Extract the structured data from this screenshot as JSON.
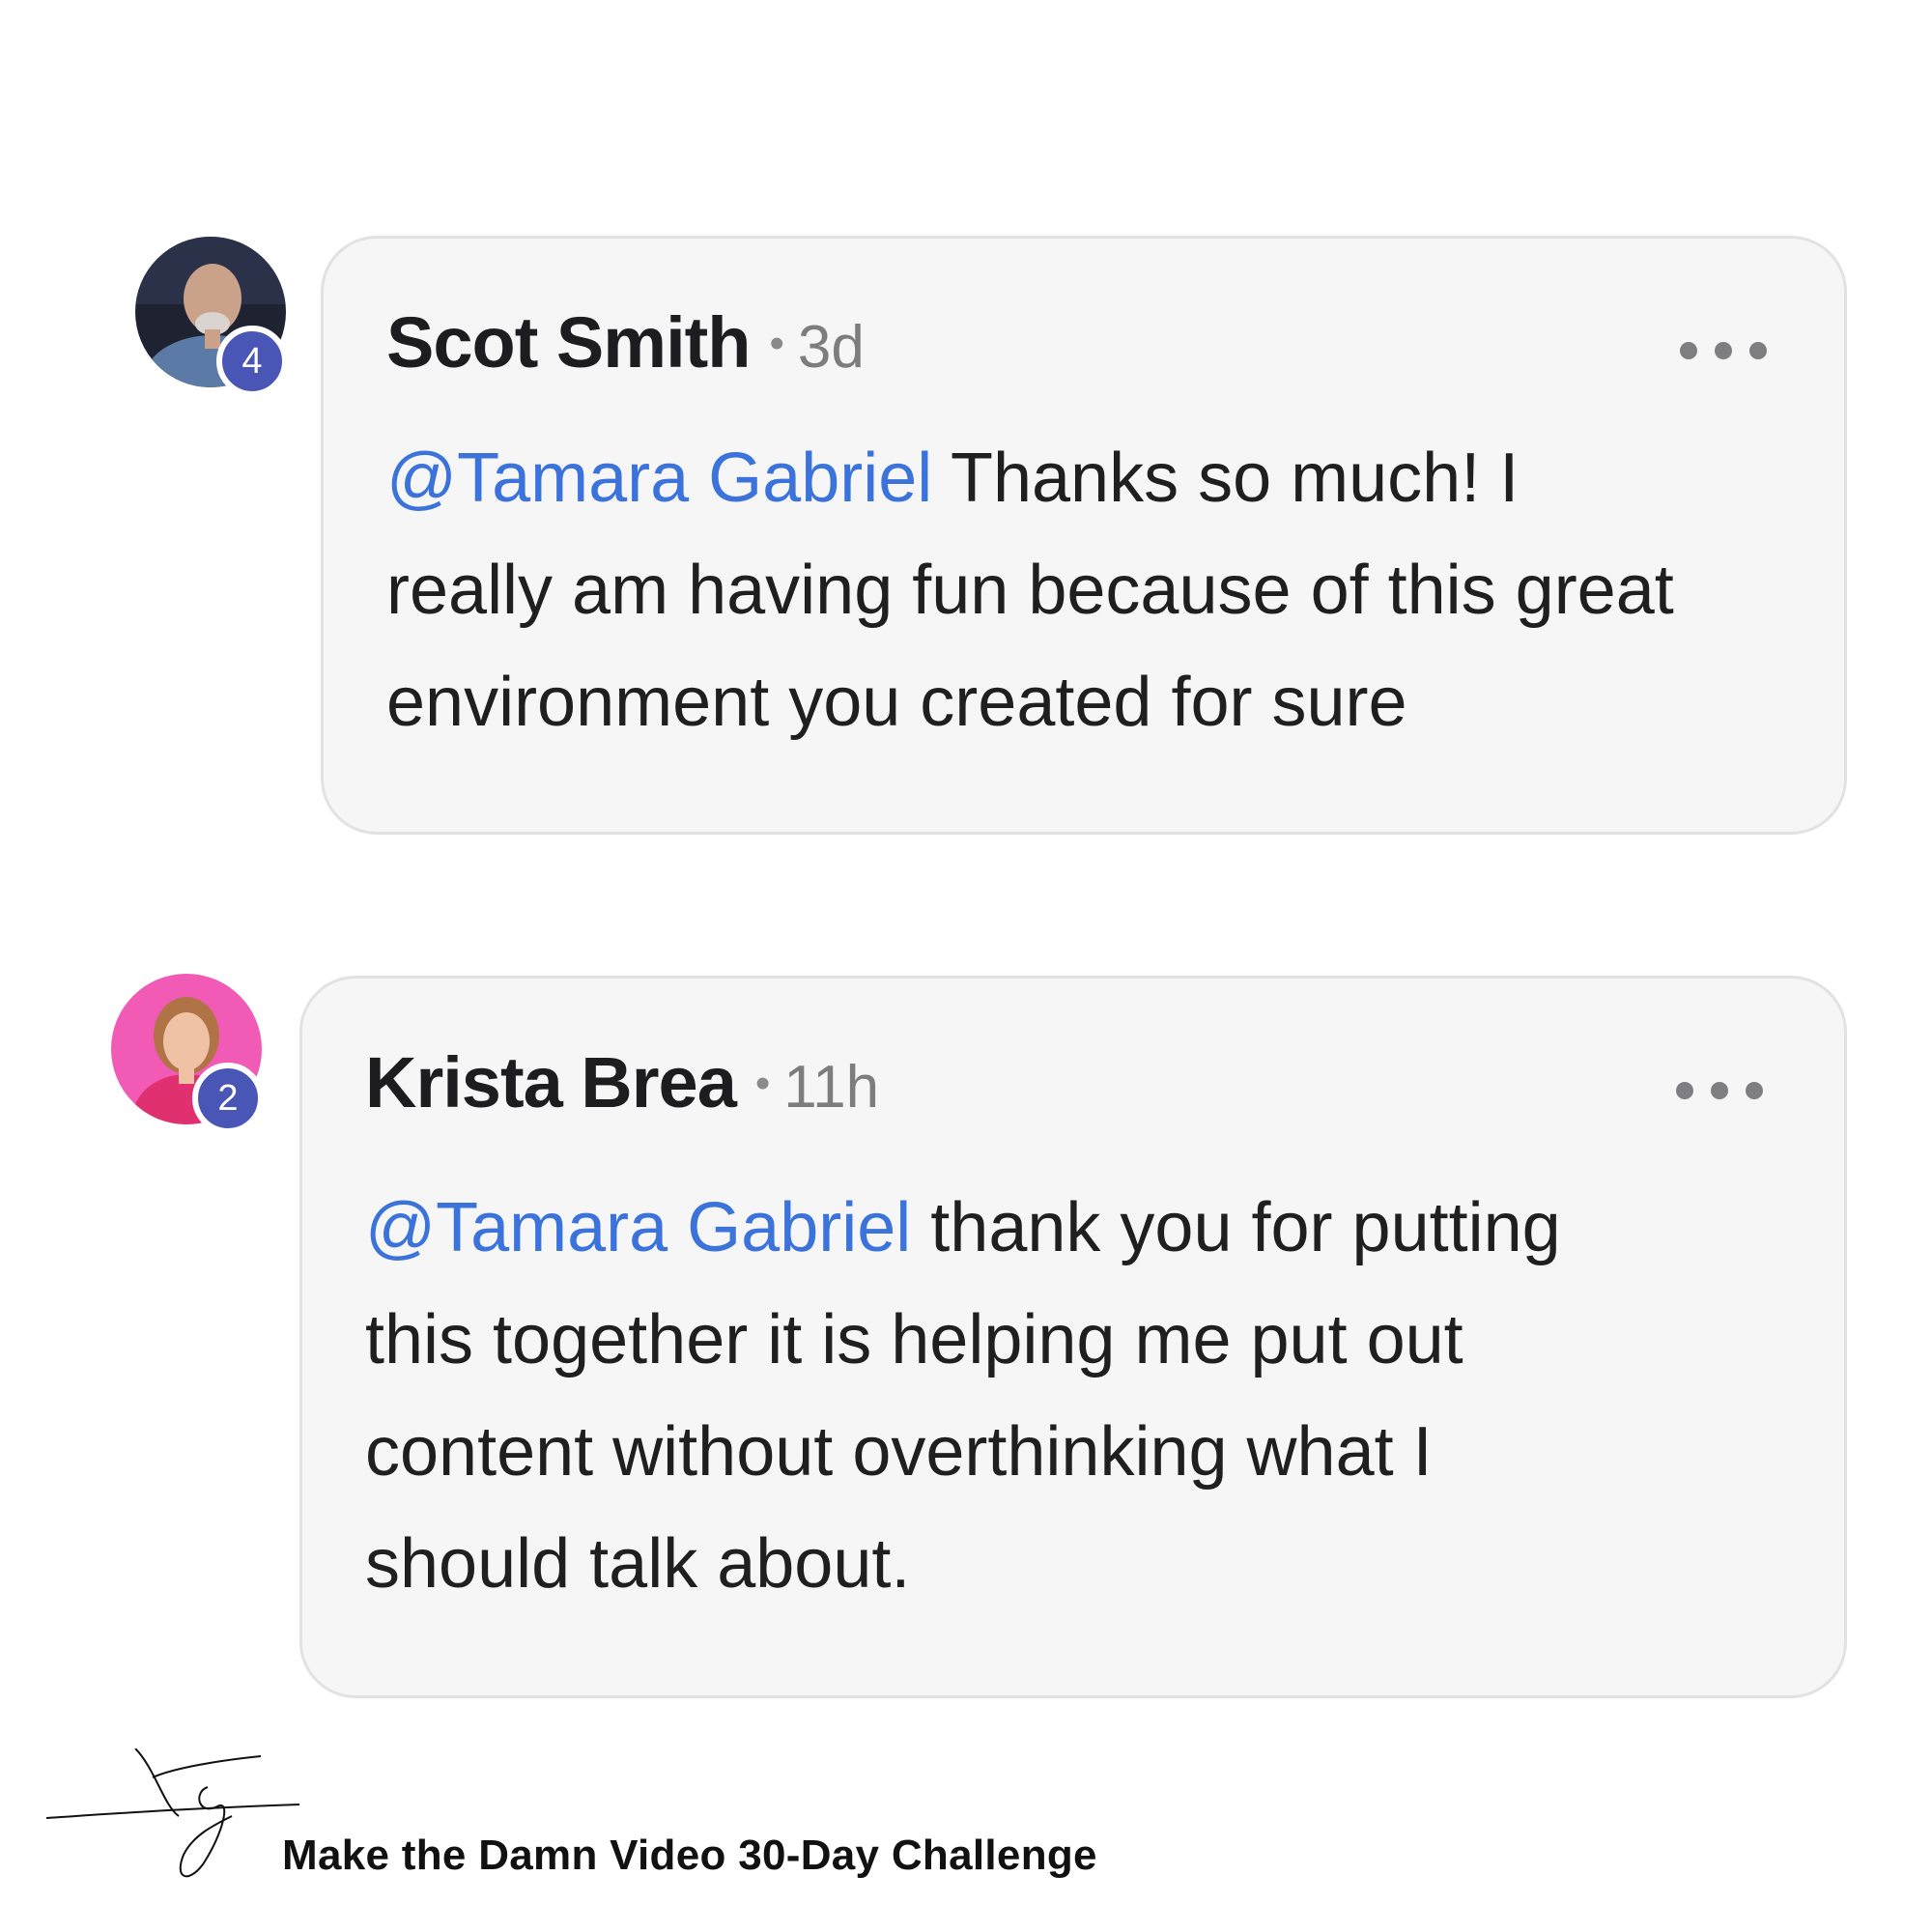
{
  "comments": [
    {
      "author": "Scot Smith",
      "separator": "•",
      "time": "3d",
      "level": "4",
      "mention": "@Tamara Gabriel",
      "line1": " Thanks so much! I",
      "line2": "really am having fun because of this great",
      "line3": "environment you created for sure",
      "line4": ""
    },
    {
      "author": "Krista Brea",
      "separator": "•",
      "time": "11h",
      "level": "2",
      "mention": "@Tamara Gabriel",
      "line1": " thank you for putting",
      "line2": "this together it is helping me put out",
      "line3": "content without overthinking what I",
      "line4": "should talk about."
    }
  ],
  "footer": {
    "title": "Make the Damn Video 30-Day Challenge",
    "logo_icon": "tg-signature-logo"
  },
  "colors": {
    "mention": "#3b73db",
    "badge": "#4a56b6",
    "bubble": "#f6f6f6",
    "avatar2_bg": "#f15bb5"
  }
}
